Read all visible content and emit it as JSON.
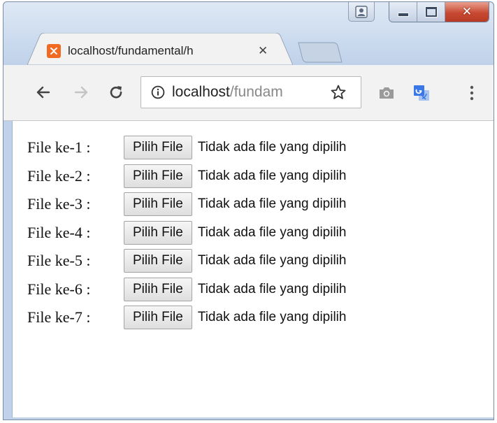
{
  "window": {
    "controls": {
      "profile": "profile-icon",
      "minimize": "minimize-icon",
      "maximize": "maximize-icon",
      "close": "close-icon"
    }
  },
  "tab": {
    "title": "localhost/fundamental/h",
    "close_glyph": "✕",
    "favicon_color": "#f06a24"
  },
  "toolbar": {
    "url_host": "localhost",
    "url_path": "/fundam"
  },
  "content": {
    "button_label": "Pilih File",
    "rows": [
      {
        "label": "File ke-1 :",
        "status": "Tidak ada file yang dipilih"
      },
      {
        "label": "File ke-2 :",
        "status": "Tidak ada file yang dipilih"
      },
      {
        "label": "File ke-3 :",
        "status": "Tidak ada file yang dipilih"
      },
      {
        "label": "File ke-4 :",
        "status": "Tidak ada file yang dipilih"
      },
      {
        "label": "File ke-5 :",
        "status": "Tidak ada file yang dipilih"
      },
      {
        "label": "File ke-6 :",
        "status": "Tidak ada file yang dipilih"
      },
      {
        "label": "File ke-7 :",
        "status": "Tidak ada file yang dipilih"
      }
    ]
  }
}
